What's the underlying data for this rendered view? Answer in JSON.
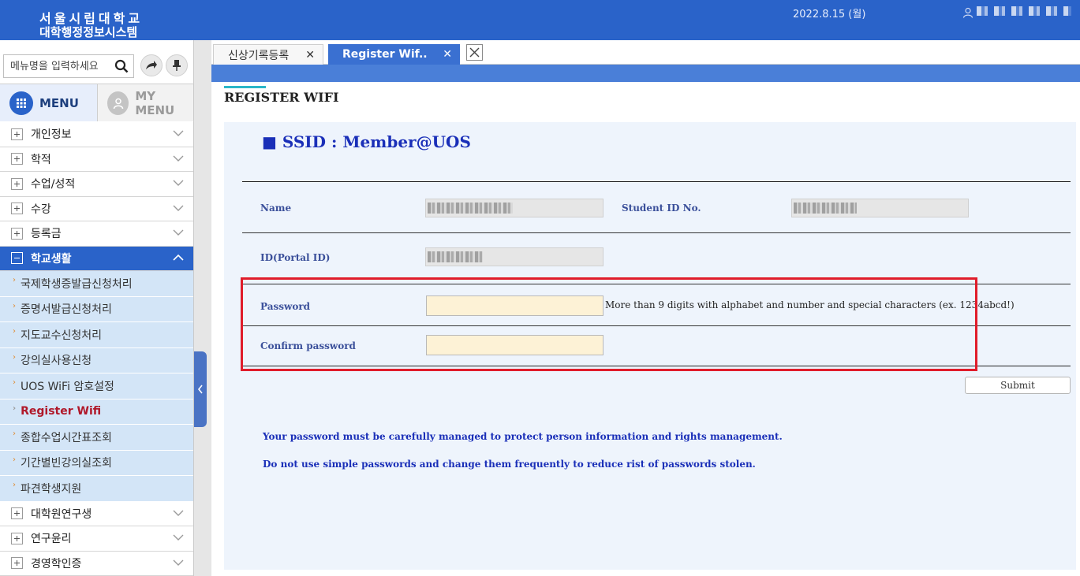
{
  "header": {
    "university_name": "서울시립대학교",
    "system_name": "대학행정정보시스템",
    "date": "2022.8.15 (월)"
  },
  "sidebar": {
    "search_placeholder": "메뉴명을 입력하세요",
    "tab_menu": "MENU",
    "tab_mymenu": "MY MENU",
    "items_top": [
      "개인정보",
      "학적",
      "수업/성적",
      "수강",
      "등록금"
    ],
    "open_item": "학교생활",
    "sub_items": [
      "국제학생증발급신청처리",
      "증명서발급신청처리",
      "지도교수신청처리",
      "강의실사용신청",
      "UOS WiFi 암호설정",
      "Register Wifi",
      "종합수업시간표조회",
      "기간별빈강의실조회",
      "파견학생지원"
    ],
    "items_bottom": [
      "대학원연구생",
      "연구윤리",
      "경영학인증"
    ]
  },
  "tabs": {
    "tab1": "신상기록등록",
    "tab2": "Register Wif.."
  },
  "content": {
    "page_title": "REGISTER WIFI",
    "ssid": "■ SSID : Member@UOS",
    "name_label": "Name",
    "student_id_label": "Student ID No.",
    "portal_id_label": "ID(Portal ID)",
    "password_label": "Password",
    "password_hint": "More than 9 digits with alphabet and number and special characters (ex. 1234abcd!)",
    "confirm_label": "Confirm password",
    "submit_label": "Submit",
    "notice1": "Your password must be carefully managed to protect person information and rights management.",
    "notice2": "Do not use simple passwords and change them frequently to reduce rist of passwords stolen."
  },
  "colors": {
    "brand_blue": "#2a63c9",
    "highlight_red": "#e01c2a",
    "notice_blue": "#1a2fb8"
  }
}
